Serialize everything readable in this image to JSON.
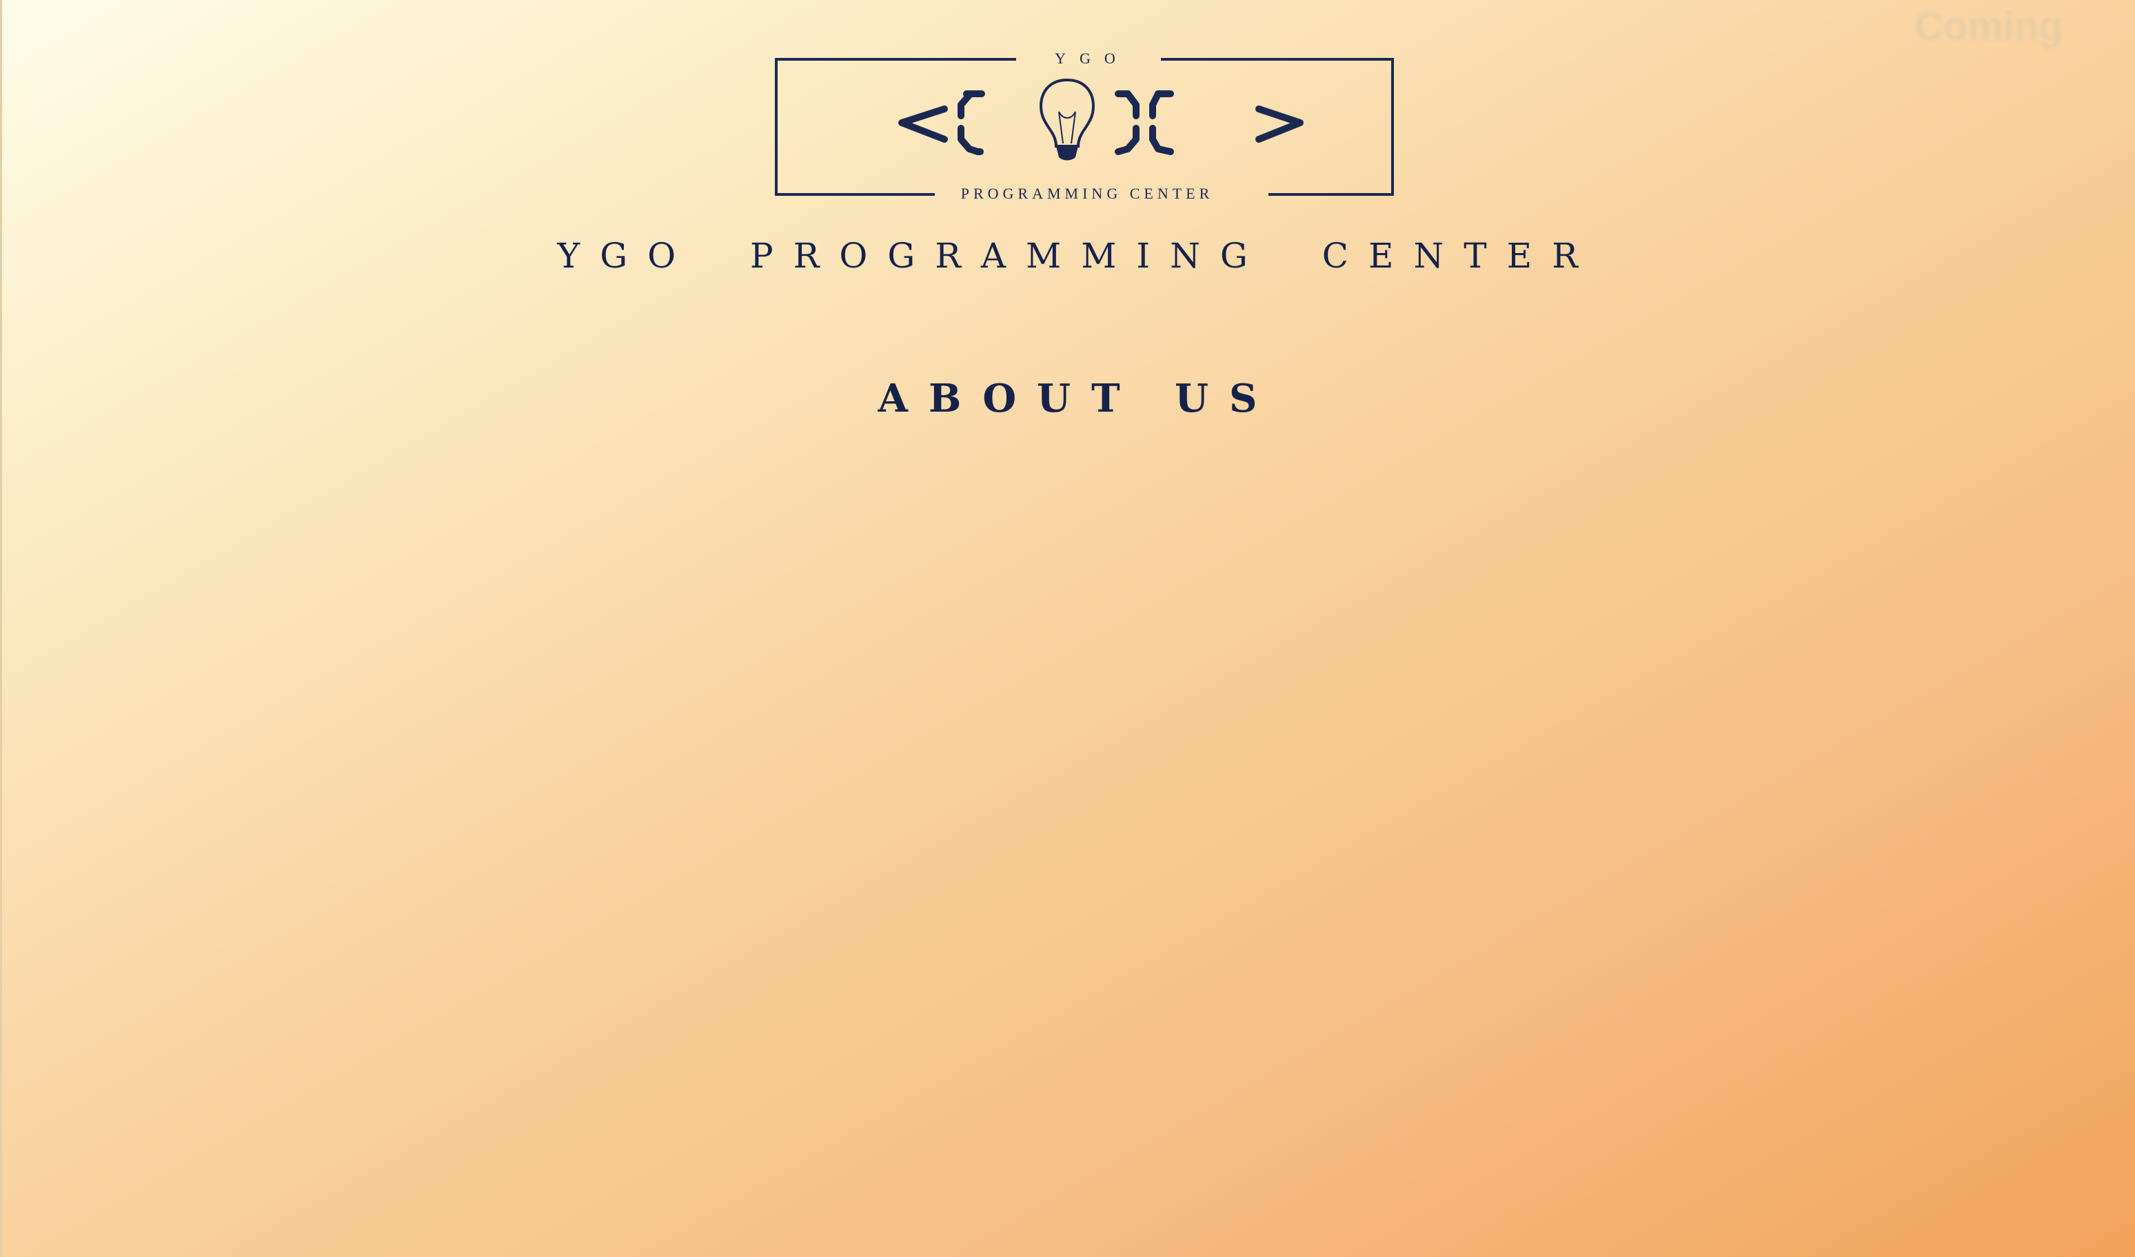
{
  "logo": {
    "top_text": "YGO",
    "bottom_text": "PROGRAMMING CENTER",
    "word": "CODE",
    "color": "#1b2952"
  },
  "header": {
    "site_title": "YGO PROGRAMMING CENTER"
  },
  "main": {
    "heading": "ABOUT US"
  },
  "corner": {
    "watermark_text": "Coming"
  },
  "colors": {
    "text": "#15224a",
    "background_start": "#fffde8",
    "background_end": "#f2a35d"
  }
}
